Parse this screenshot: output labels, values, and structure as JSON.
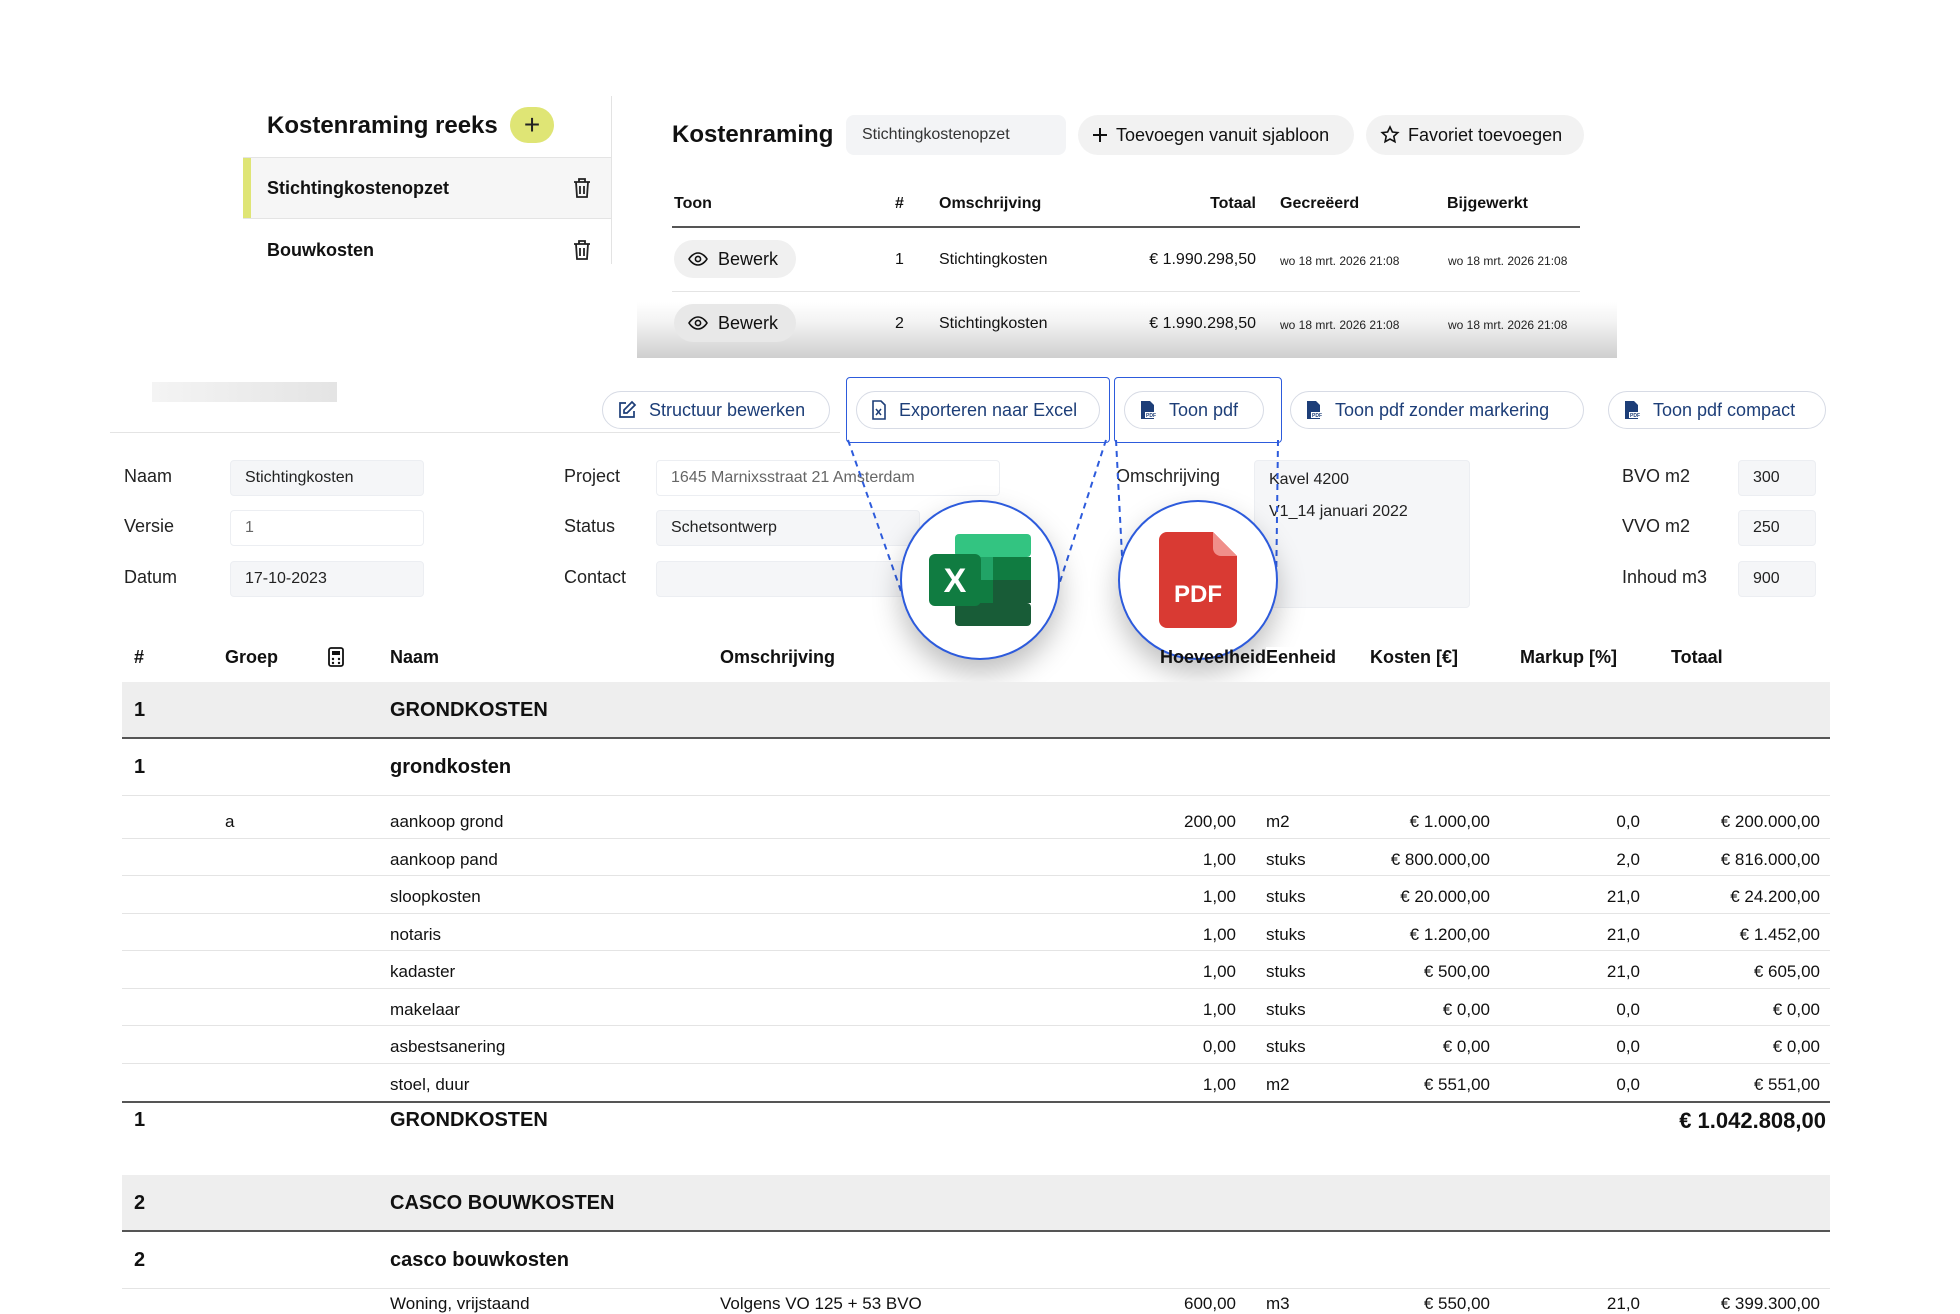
{
  "series": {
    "title": "Kostenraming reeks",
    "add_label": "+",
    "items": [
      {
        "label": "Stichtingkostenopzet"
      },
      {
        "label": "Bouwkosten"
      }
    ]
  },
  "estimate": {
    "title": "Kostenraming",
    "current_name": "Stichtingkostenopzet",
    "add_template_label": "Toevoegen vanuit sjabloon",
    "favorite_label": "Favoriet toevoegen",
    "columns": [
      "Toon",
      "#",
      "Omschrijving",
      "Totaal",
      "Gecreëerd",
      "Bijgewerkt"
    ],
    "rows": [
      {
        "action": "Bewerk",
        "num": "1",
        "desc": "Stichtingkosten",
        "total": "€ 1.990.298,50",
        "created": "wo 18 mrt. 2026 21:08",
        "updated": "wo 18 mrt. 2026 21:08"
      },
      {
        "action": "Bewerk",
        "num": "2",
        "desc": "Stichtingkosten",
        "total": "€ 1.990.298,50",
        "created": "wo 18 mrt. 2026 21:08",
        "updated": "wo 18 mrt. 2026 21:08"
      }
    ]
  },
  "actions": {
    "edit_structure": "Structuur bewerken",
    "export_excel": "Exporteren naar Excel",
    "show_pdf": "Toon pdf",
    "show_pdf_nomark": "Toon pdf zonder markering",
    "show_pdf_compact": "Toon pdf compact"
  },
  "form": {
    "naam_label": "Naam",
    "naam_value": "Stichtingkosten",
    "versie_label": "Versie",
    "versie_value": "1",
    "datum_label": "Datum",
    "datum_value": "17-10-2023",
    "project_label": "Project",
    "project_value": "1645 Marnixsstraat 21 Amsterdam",
    "status_label": "Status",
    "status_value": "Schetsontwerp",
    "contact_label": "Contact",
    "contact_value": "",
    "omschrijving_label": "Omschrijving",
    "omschrijving_line1": "Kavel 4200",
    "omschrijving_line2": "V1_14 januari 2022",
    "bvo_label": "BVO m2",
    "bvo_value": "300",
    "vvo_label": "VVO m2",
    "vvo_value": "250",
    "inhoud_label": "Inhoud m3",
    "inhoud_value": "900"
  },
  "badges": {
    "excel_letter": "X",
    "pdf_text": "PDF",
    "pdf_small": "PDF"
  },
  "main": {
    "headers": {
      "num": "#",
      "groep": "Groep",
      "naam": "Naam",
      "omschrijving": "Omschrijving",
      "hoeveelheid": "Hoeveelheid",
      "eenheid": "Eenheid",
      "kosten": "Kosten [€]",
      "markup": "Markup [%]",
      "totaal": "Totaal"
    },
    "group1": {
      "num": "1",
      "title": "GRONDKOSTEN"
    },
    "sub1": {
      "num": "1",
      "title": "grondkosten"
    },
    "rows": [
      {
        "groep": "a",
        "naam": "aankoop grond",
        "omschrijving": "",
        "hoeveelheid": "200,00",
        "eenheid": "m2",
        "kosten": "€ 1.000,00",
        "markup": "0,0",
        "totaal": "€ 200.000,00"
      },
      {
        "groep": "",
        "naam": "aankoop pand",
        "omschrijving": "",
        "hoeveelheid": "1,00",
        "eenheid": "stuks",
        "kosten": "€ 800.000,00",
        "markup": "2,0",
        "totaal": "€ 816.000,00"
      },
      {
        "groep": "",
        "naam": "sloopkosten",
        "omschrijving": "",
        "hoeveelheid": "1,00",
        "eenheid": "stuks",
        "kosten": "€ 20.000,00",
        "markup": "21,0",
        "totaal": "€ 24.200,00"
      },
      {
        "groep": "",
        "naam": "notaris",
        "omschrijving": "",
        "hoeveelheid": "1,00",
        "eenheid": "stuks",
        "kosten": "€ 1.200,00",
        "markup": "21,0",
        "totaal": "€ 1.452,00"
      },
      {
        "groep": "",
        "naam": "kadaster",
        "omschrijving": "",
        "hoeveelheid": "1,00",
        "eenheid": "stuks",
        "kosten": "€ 500,00",
        "markup": "21,0",
        "totaal": "€ 605,00"
      },
      {
        "groep": "",
        "naam": "makelaar",
        "omschrijving": "",
        "hoeveelheid": "1,00",
        "eenheid": "stuks",
        "kosten": "€ 0,00",
        "markup": "0,0",
        "totaal": "€ 0,00"
      },
      {
        "groep": "",
        "naam": "asbestsanering",
        "omschrijving": "",
        "hoeveelheid": "0,00",
        "eenheid": "stuks",
        "kosten": "€ 0,00",
        "markup": "0,0",
        "totaal": "€ 0,00"
      },
      {
        "groep": "",
        "naam": "stoel, duur",
        "omschrijving": "",
        "hoeveelheid": "1,00",
        "eenheid": "m2",
        "kosten": "€ 551,00",
        "markup": "0,0",
        "totaal": "€ 551,00"
      }
    ],
    "group1_total": {
      "num": "1",
      "title": "GRONDKOSTEN",
      "total": "€ 1.042.808,00"
    },
    "group2": {
      "num": "2",
      "title": "CASCO BOUWKOSTEN"
    },
    "sub2": {
      "num": "2",
      "title": "casco bouwkosten"
    },
    "row2": {
      "groep": "",
      "naam": "Woning, vrijstaand",
      "omschrijving": "Volgens VO 125 + 53 BVO",
      "hoeveelheid": "600,00",
      "eenheid": "m3",
      "kosten": "€ 550,00",
      "markup": "21,0",
      "totaal": "€ 399.300,00"
    }
  },
  "colors": {
    "accent": "#dfe575",
    "link": "#1d3e78",
    "highlight": "#2d5bdc",
    "excel": "#1d7044",
    "pdf": "#d93a33"
  }
}
